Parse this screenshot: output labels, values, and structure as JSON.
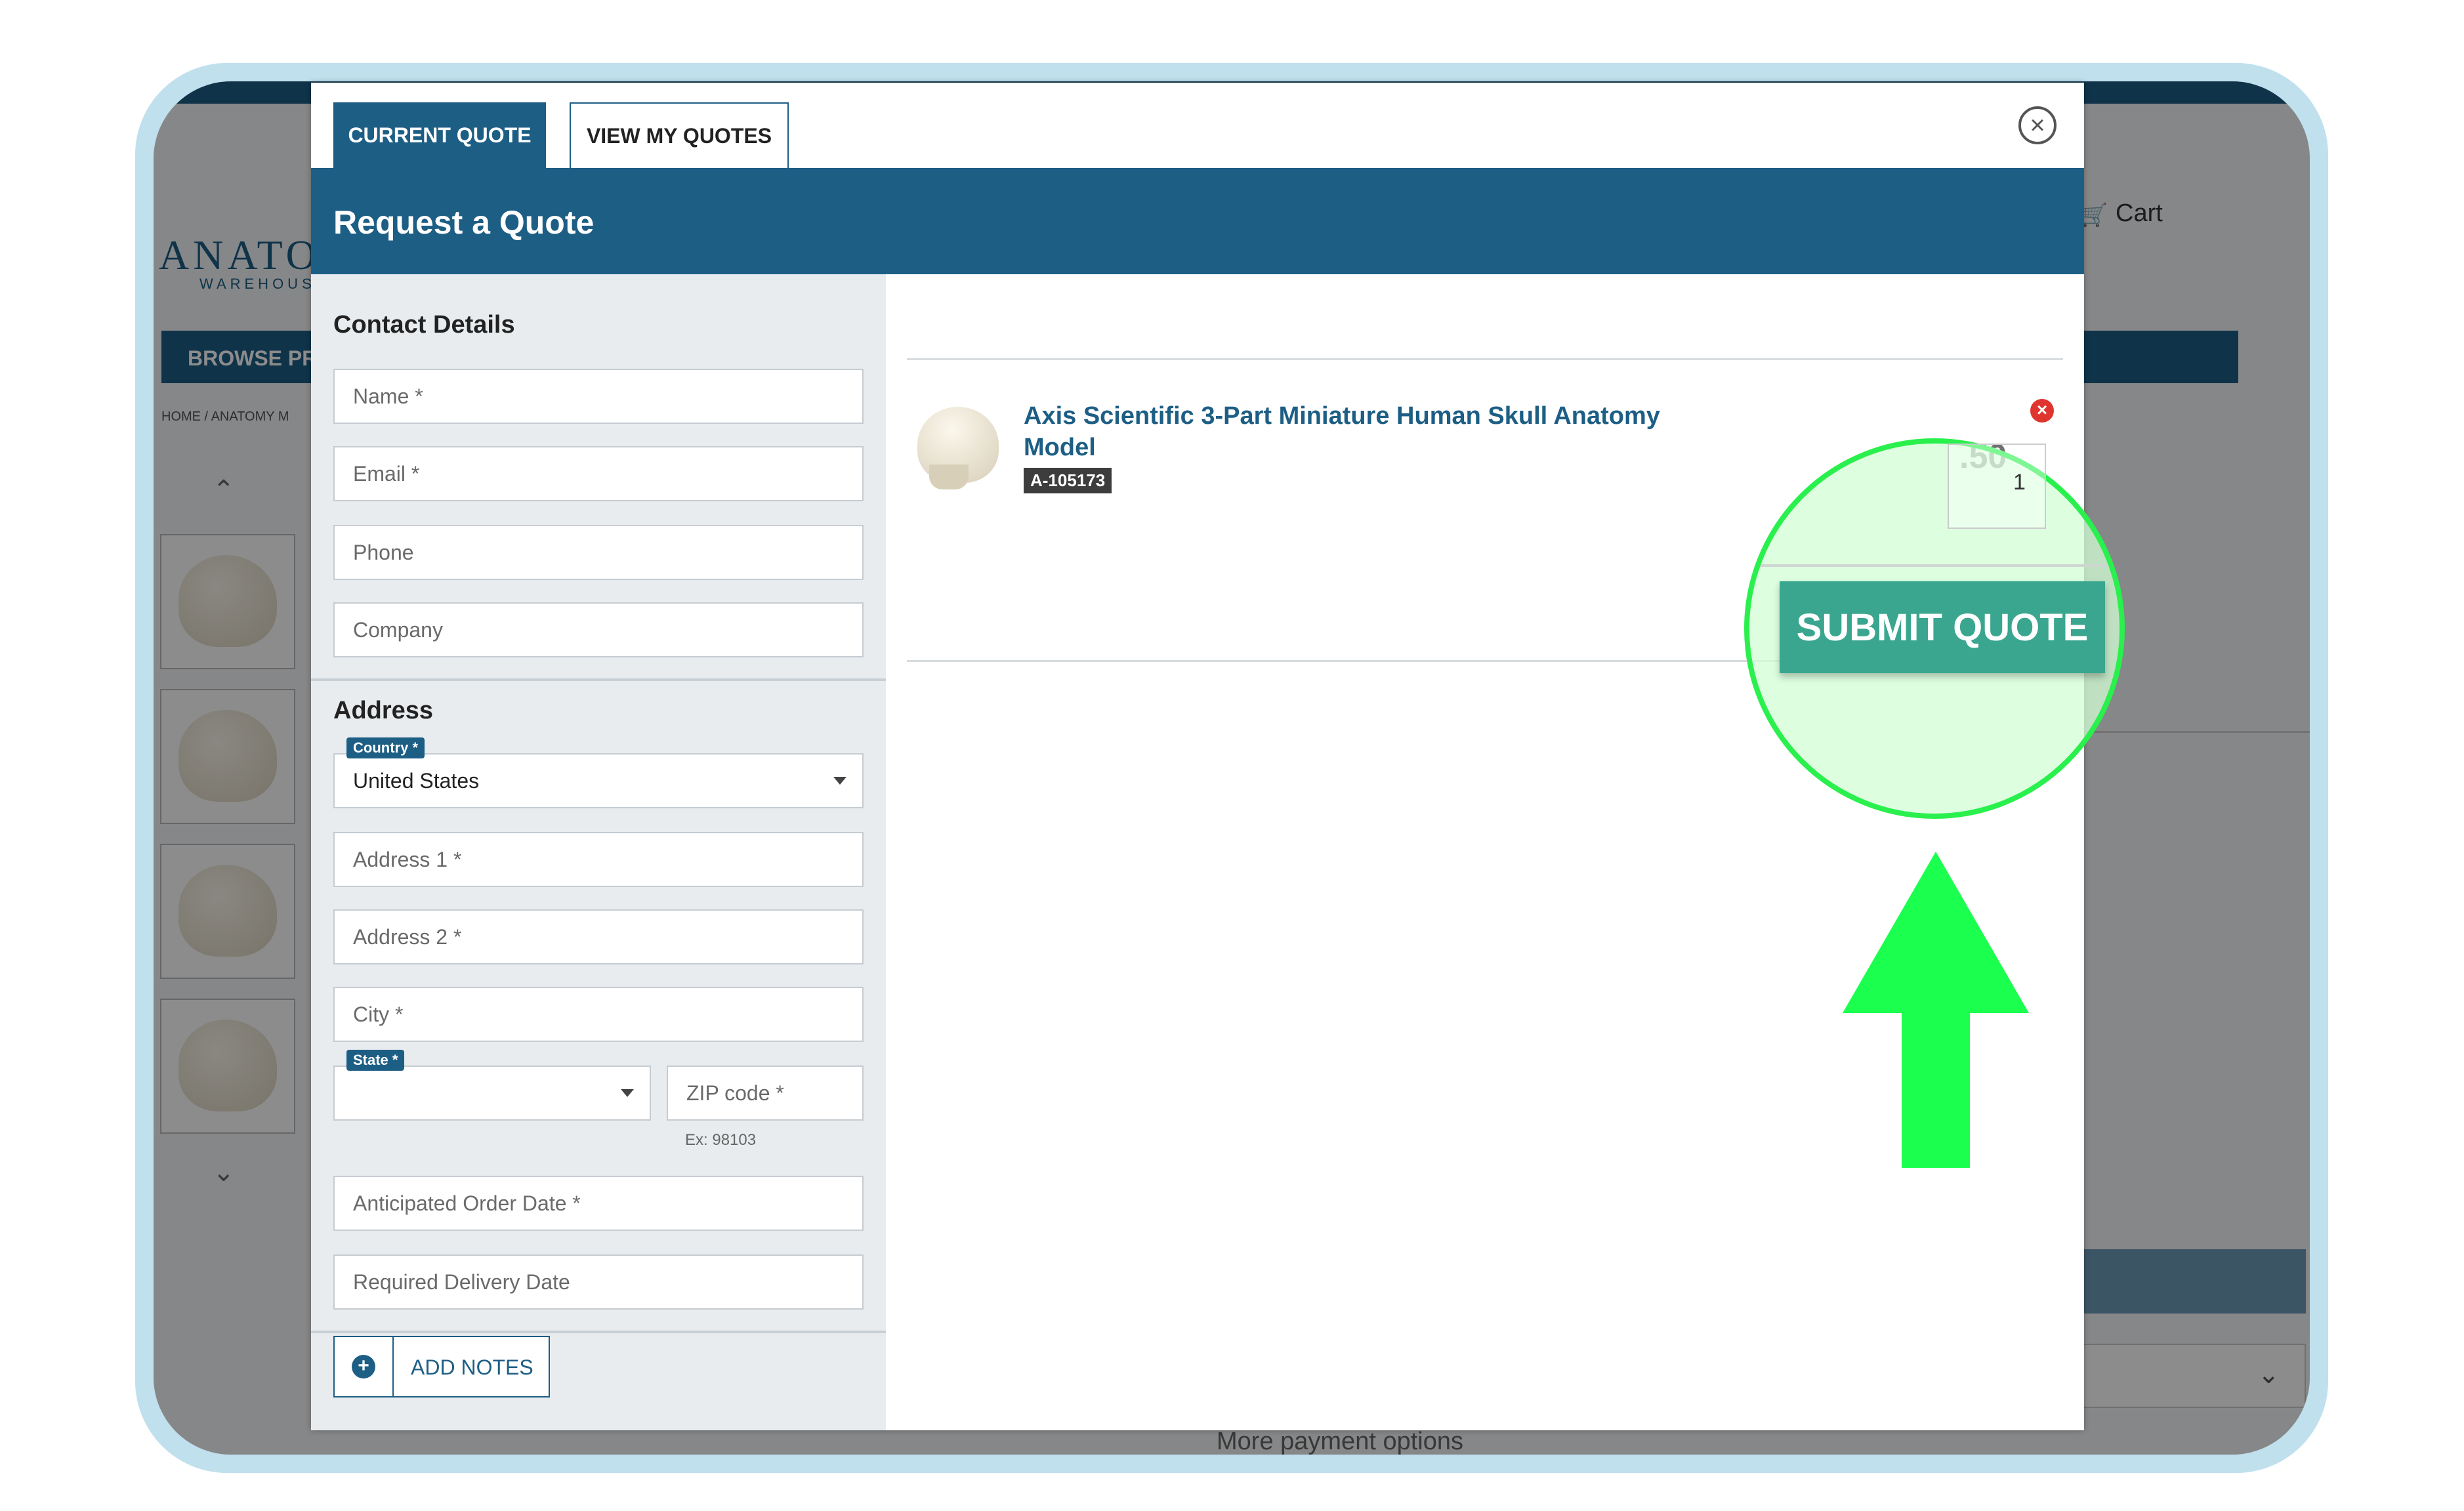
{
  "background_page": {
    "logo_text": "ANATOM",
    "logo_sub": "WAREHOUSE",
    "browse_label": "BROWSE PRO",
    "breadcrumb": "HOME / ANATOMY M",
    "cart_label": "Cart",
    "more_payment": "More payment options"
  },
  "modal": {
    "tabs": [
      {
        "label": "CURRENT QUOTE",
        "active": true
      },
      {
        "label": "VIEW MY QUOTES",
        "active": false
      }
    ],
    "title": "Request a Quote",
    "contact": {
      "section_title": "Contact Details",
      "fields": {
        "name": "Name *",
        "email": "Email *",
        "phone": "Phone",
        "company": "Company"
      }
    },
    "address": {
      "section_title": "Address",
      "country_badge": "Country *",
      "country_value": "United States",
      "address1": "Address 1 *",
      "address2": "Address 2 *",
      "city": "City *",
      "state_badge": "State *",
      "zip": "ZIP code *",
      "zip_hint": "Ex: 98103",
      "anticipated_date": "Anticipated Order Date *",
      "delivery_date": "Required Delivery Date"
    },
    "add_notes_label": "ADD NOTES",
    "cart_item": {
      "title": "Axis Scientific 3-Part Miniature Human Skull Anatomy Model",
      "sku": "A-105173",
      "price_visible": ".50",
      "quantity": "1"
    },
    "submit_label": "SUBMIT QUOTE"
  },
  "colors": {
    "brand": "#1d5e85",
    "submit": "#3aa68f",
    "highlight": "#2af04d",
    "remove": "#e0342e"
  },
  "icons": {
    "close": "close-circle-icon",
    "remove": "remove-item-icon",
    "add": "plus-circle-icon",
    "caret": "caret-down-icon",
    "cart": "cart-icon"
  }
}
